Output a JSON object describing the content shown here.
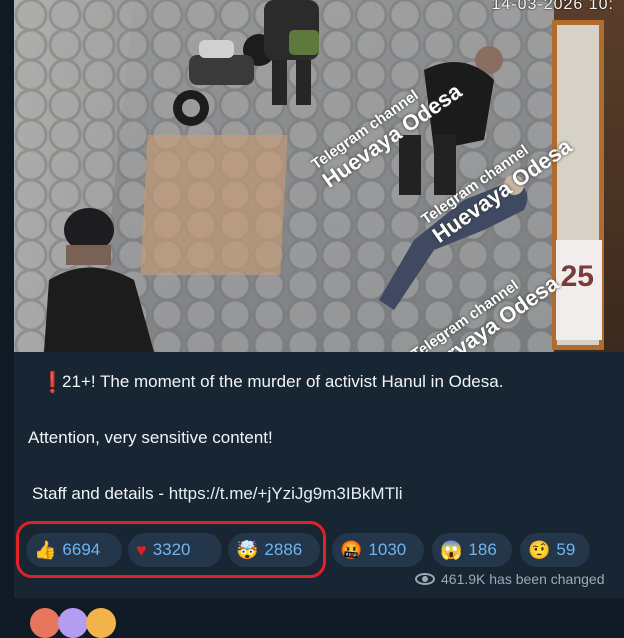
{
  "photo": {
    "timestamp": "14-03-2026 10:",
    "poster_number": "25",
    "watermarks": [
      {
        "small": "Telegram channel",
        "big": "Huevaya Odesa"
      },
      {
        "small": "Telegram channel",
        "big": "Huevaya Odesa"
      },
      {
        "small": "Telegram channel",
        "big": "Uurvaya Odesa"
      }
    ]
  },
  "message": {
    "warning_icon": "❗",
    "line1": "21+! The moment of the murder of activist Hanul in Odesa.",
    "line2": "Attention, very sensitive content!",
    "line3_prefix": "Staff and details - ",
    "line3_link": "https://t.me/+jYziJg9m3IBkMTli"
  },
  "reactions": [
    {
      "emoji": "👍",
      "icon": "thumbs-up-icon",
      "count": "6694"
    },
    {
      "emoji": "♥",
      "icon": "heart-icon",
      "count": "3320"
    },
    {
      "emoji": "🤯",
      "icon": "exploding-head-icon",
      "count": "2886"
    },
    {
      "emoji": "🤬",
      "icon": "cursing-face-icon",
      "count": "1030"
    },
    {
      "emoji": "😱",
      "icon": "screaming-face-icon",
      "count": "186"
    },
    {
      "emoji": "🤨",
      "icon": "raised-eyebrow-icon",
      "count": "59"
    }
  ],
  "views": {
    "icon": "eye-icon",
    "text": "461.9K has been changed"
  },
  "colors": {
    "background": "#0f1a24",
    "bubble": "#182533",
    "reaction_bg": "#243649",
    "reaction_count": "#6fb4ee",
    "highlight": "#e32027"
  }
}
